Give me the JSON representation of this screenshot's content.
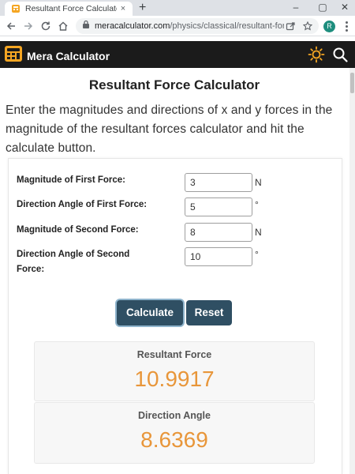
{
  "browser": {
    "tab_title": "Resultant Force Calculator",
    "tab_close": "×",
    "new_tab": "+",
    "url_host": "meracalculator.com",
    "url_path": "/physics/classical/resultant-force....",
    "profile_initial": "R",
    "window_minimize": "–",
    "window_maximize": "▢",
    "window_close": "✕"
  },
  "site": {
    "logo_text": "Mera Calculator",
    "accent_color": "#f5a623",
    "header_color": "#1b1b1b"
  },
  "page": {
    "title": "Resultant Force Calculator",
    "intro": "Enter the magnitudes and directions of x and y forces in the magnitude of the resultant forces calculator and hit the calculate button."
  },
  "form": {
    "fields": [
      {
        "label": "Magnitude of First Force:",
        "value": "3",
        "unit": "N"
      },
      {
        "label": "Direction Angle of First Force:",
        "value": "5",
        "unit": "°"
      },
      {
        "label": "Magnitude of Second Force:",
        "value": "8",
        "unit": "N"
      },
      {
        "label": "Direction Angle of Second Force:",
        "value": "10",
        "unit": "°"
      }
    ],
    "calculate_label": "Calculate",
    "reset_label": "Reset",
    "button_color": "#2f4f63"
  },
  "results": [
    {
      "label": "Resultant Force",
      "value": "10.9917"
    },
    {
      "label": "Direction Angle",
      "value": "8.6369"
    }
  ],
  "result_color": "#e8963a"
}
